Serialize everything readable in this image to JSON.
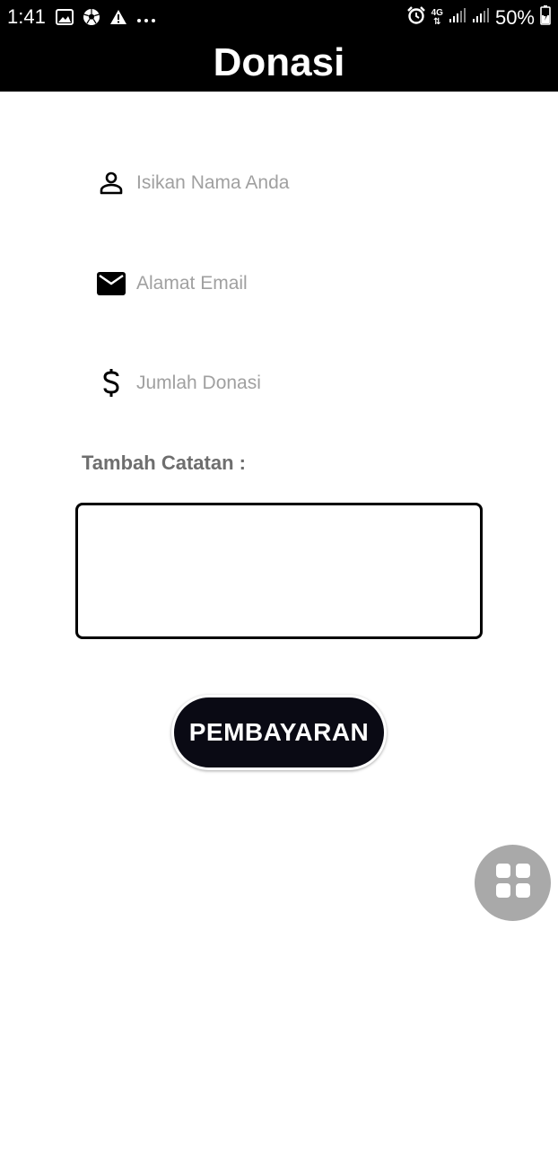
{
  "status_bar": {
    "time": "1:41",
    "network_type": "4G",
    "battery_percent": "50%",
    "left_icons": [
      "gallery-icon",
      "soccer-ball-icon",
      "warning-icon",
      "more-dots-icon"
    ],
    "right_icons": [
      "alarm-icon",
      "signal-icon",
      "signal-icon",
      "battery-charging-icon"
    ]
  },
  "header": {
    "title": "Donasi"
  },
  "form": {
    "name": {
      "icon": "person-icon",
      "placeholder": "Isikan Nama Anda",
      "value": ""
    },
    "email": {
      "icon": "mail-icon",
      "placeholder": "Alamat Email",
      "value": ""
    },
    "amount": {
      "icon": "dollar-icon",
      "placeholder": "Jumlah Donasi",
      "value": ""
    },
    "notes_label": "Tambah Catatan :",
    "notes_value": "",
    "submit_label": "PEMBAYARAN"
  },
  "floating_button": {
    "icon": "grid-icon",
    "color": "#a9a9a9"
  }
}
